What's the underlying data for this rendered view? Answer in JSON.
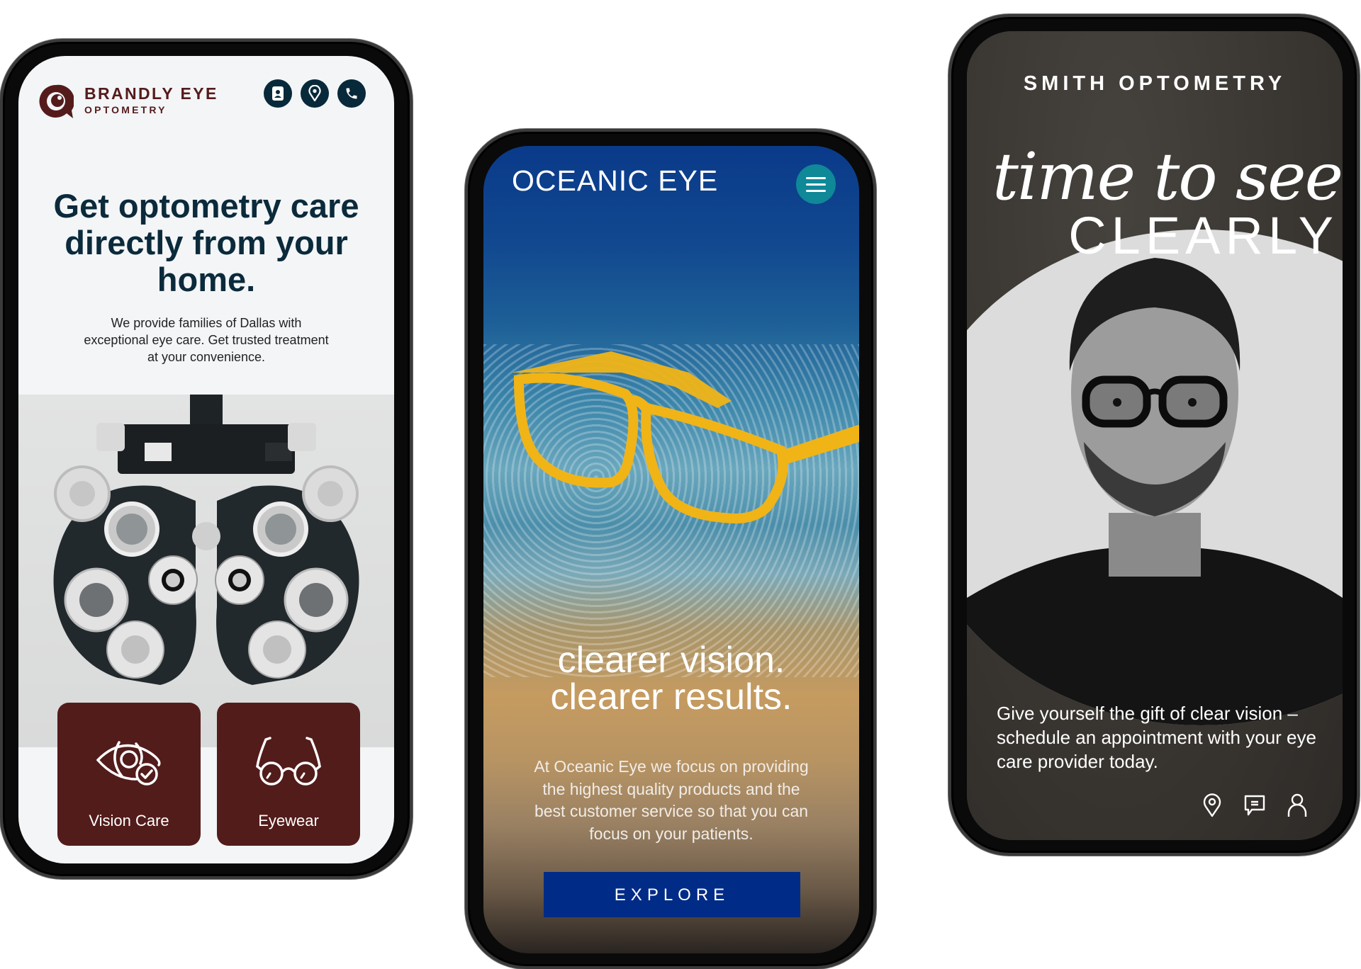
{
  "brandly": {
    "logo_name": "BRANDLY EYE",
    "logo_sub": "OPTOMETRY",
    "header_icons": [
      "contact-card-icon",
      "location-pin-icon",
      "phone-icon"
    ],
    "headline": "Get optometry care directly from your home.",
    "intro": "We provide families of Dallas with exceptional eye care. Get trusted treatment at your convenience.",
    "hero_image": "phoropter",
    "tiles": [
      {
        "label": "Vision Care",
        "icon": "eye-check-icon"
      },
      {
        "label": "Eyewear",
        "icon": "eyeglasses-icon"
      }
    ],
    "colors": {
      "brand": "#551b1b",
      "navy": "#08293a",
      "tile": "#521c1b",
      "background": "#f3f5f7"
    }
  },
  "oceanic": {
    "logo": "OCEANIC EYE",
    "menu_icon": "hamburger-menu-icon",
    "hero_image": "yellow-glasses-over-beach",
    "headline_line1": "clearer vision.",
    "headline_line2": "clearer results.",
    "body": "At Oceanic Eye we focus on providing the highest quality products and the best customer service so that you can focus on your patients.",
    "cta_label": "EXPLORE",
    "colors": {
      "menu": "#0f8898",
      "cta": "#002b86",
      "glasses": "#f0b417"
    }
  },
  "smith": {
    "logo": "SMITH OPTOMETRY",
    "script_headline": "time to see",
    "headline_caps": "CLEARLY",
    "hero_image": "man-with-black-glasses",
    "body": "Give yourself the gift of clear vision – schedule an appointment with your eye care provider today.",
    "bottom_icons": [
      "location-pin-icon",
      "chat-icon",
      "user-icon"
    ],
    "colors": {
      "background": "#3b3733",
      "arc": "#dcdcdc"
    }
  }
}
